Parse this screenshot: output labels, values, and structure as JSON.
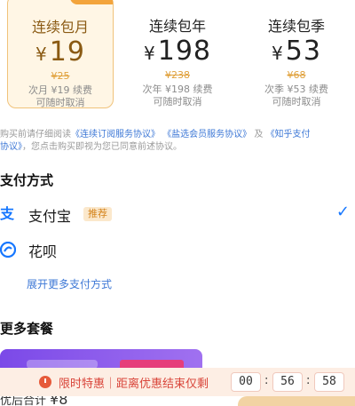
{
  "plans": [
    {
      "title": "连续包月",
      "currency": "¥",
      "price": "19",
      "original": "¥25",
      "note1": "次月 ¥19 续费",
      "note2": "可随时取消",
      "selected": true
    },
    {
      "title": "连续包年",
      "currency": "¥",
      "price": "198",
      "original": "¥238",
      "note1": "次年 ¥198 续费",
      "note2": "可随时取消",
      "selected": false
    },
    {
      "title": "连续包季",
      "currency": "¥",
      "price": "53",
      "original": "¥68",
      "note1": "次季 ¥53 续费",
      "note2": "可随时取消",
      "selected": false
    }
  ],
  "agreement": {
    "prefix": "购买前请仔细阅读",
    "link1": "《连续订阅服务协议》",
    "link2": "《盐选会员服务协议》",
    "and": "及",
    "link3": "《知乎支付",
    "link3_cont": "协议》",
    "suffix": "，您点击购买即视为您已同意前述协议。"
  },
  "payment": {
    "title": "支付方式",
    "methods": [
      {
        "label": "支付宝",
        "tag": "推荐",
        "icon": "alipay-icon",
        "checked": true
      },
      {
        "label": "花呗",
        "tag": "",
        "icon": "huabei-icon",
        "checked": false
      }
    ],
    "more": "展开更多支付方式",
    "check_glyph": "✓"
  },
  "more_plans": {
    "title": "更多套餐"
  },
  "timer": {
    "label": "限时特惠｜距离优惠结束仅剩",
    "hours": "00",
    "minutes": "56",
    "seconds": "58",
    "sep": ":"
  },
  "bottom": {
    "total_label": "优后合计",
    "total_amount": "¥8"
  },
  "colors": {
    "accent": "#1677ff",
    "gold": "#8a5a13",
    "timer_red": "#d9453a"
  }
}
